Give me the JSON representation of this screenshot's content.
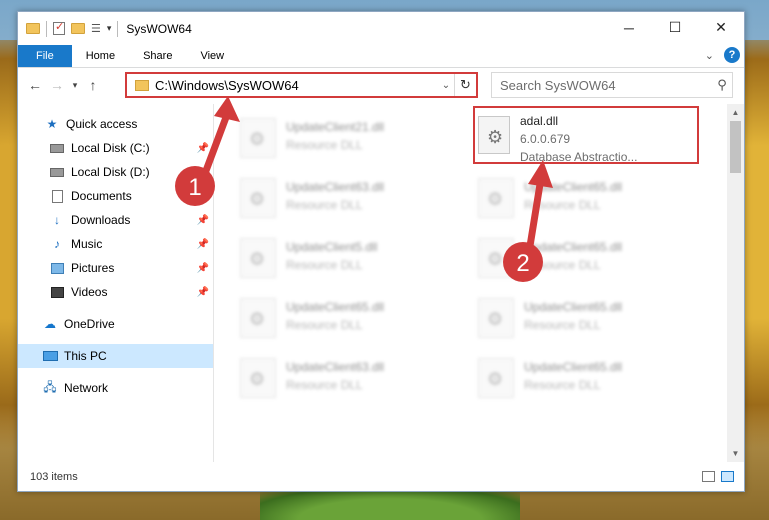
{
  "window": {
    "title": "SysWOW64",
    "controls": {
      "minimize": "─",
      "maximize": "☐",
      "close": "✕"
    }
  },
  "ribbon": {
    "tabs": [
      "File",
      "Home",
      "Share",
      "View"
    ]
  },
  "address": {
    "path": "C:\\Windows\\SysWOW64",
    "search_placeholder": "Search SysWOW64"
  },
  "sidebar": {
    "quick_access": "Quick access",
    "items": [
      {
        "label": "Local Disk (C:)",
        "pinned": true
      },
      {
        "label": "Local Disk (D:)",
        "pinned": false
      },
      {
        "label": "Documents",
        "pinned": false
      },
      {
        "label": "Downloads",
        "pinned": true
      },
      {
        "label": "Music",
        "pinned": true
      },
      {
        "label": "Pictures",
        "pinned": true
      },
      {
        "label": "Videos",
        "pinned": true
      }
    ],
    "onedrive": "OneDrive",
    "this_pc": "This PC",
    "network": "Network"
  },
  "files": [
    {
      "name": "UpdateClient21.dll",
      "type": "Resource DLL"
    },
    {
      "name": "adal.dll",
      "version": "6.0.0.679",
      "description": "Database Abstractio..."
    },
    {
      "name": "UpdateClient63.dll",
      "type": "Resource DLL"
    },
    {
      "name": "UpdateClient65.dll",
      "type": "Resource DLL"
    },
    {
      "name": "UpdateClient5.dll",
      "type": "Resource DLL"
    },
    {
      "name": "UpdateClient65.dll",
      "type": "Resource DLL"
    },
    {
      "name": "UpdateClient65.dll",
      "type": "Resource DLL"
    },
    {
      "name": "UpdateClient65.dll",
      "type": "Resource DLL"
    },
    {
      "name": "UpdateClient63.dll",
      "type": "Resource DLL"
    },
    {
      "name": "UpdateClient65.dll",
      "type": "Resource DLL"
    }
  ],
  "status": {
    "item_count": "103 items"
  },
  "annotations": {
    "badge1": "1",
    "badge2": "2",
    "color": "#d23b3b"
  }
}
